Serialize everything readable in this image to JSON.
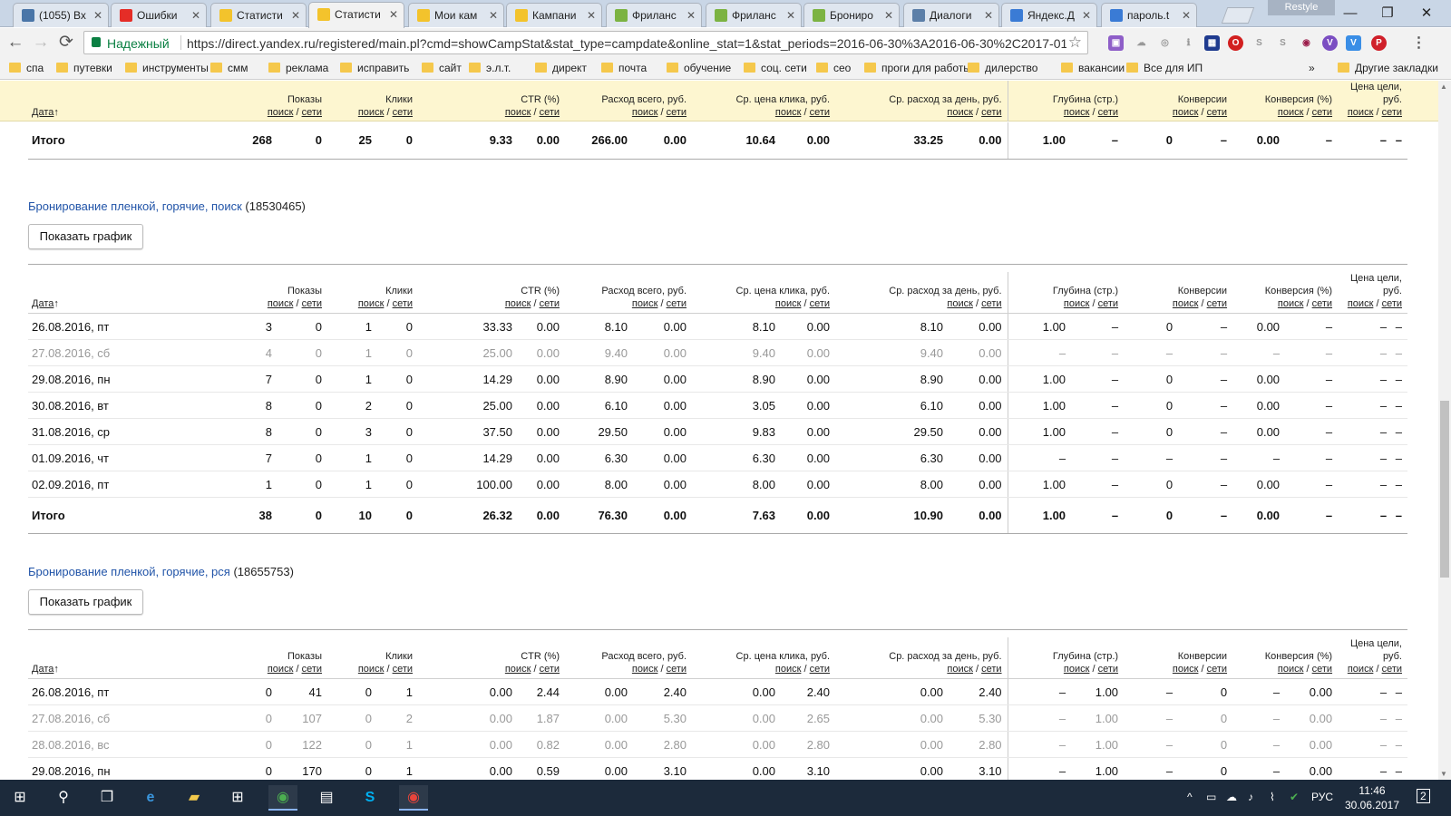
{
  "browser": {
    "tabs": [
      {
        "title": "(1055) Вх",
        "icon": "vk-icon",
        "color": "#4a76a8"
      },
      {
        "title": "Ошибки",
        "icon": "youtube-icon",
        "color": "#e52d27"
      },
      {
        "title": "Статисти",
        "icon": "yandex-direct-icon",
        "color": "#f3c32c"
      },
      {
        "title": "Статисти",
        "icon": "yandex-direct-icon",
        "color": "#f3c32c"
      },
      {
        "title": "Мои кам",
        "icon": "yandex-direct-icon",
        "color": "#f3c32c"
      },
      {
        "title": "Кампани",
        "icon": "yandex-direct-icon",
        "color": "#f3c32c"
      },
      {
        "title": "Фриланс",
        "icon": "fl-ru-icon",
        "color": "#7cb342"
      },
      {
        "title": "Фриланс",
        "icon": "fl-ru-icon",
        "color": "#7cb342"
      },
      {
        "title": "Брониро",
        "icon": "fl-ru-icon",
        "color": "#7cb342"
      },
      {
        "title": "Диалоги",
        "icon": "dialog-icon",
        "color": "#5c7fa8"
      },
      {
        "title": "Яндекс.Д",
        "icon": "yandex-disk-icon",
        "color": "#3a7bd5"
      },
      {
        "title": "пароль.t",
        "icon": "document-icon",
        "color": "#3a7bd5"
      }
    ],
    "active_tab_index": 3,
    "restyle_label": "Restyle",
    "secure_label": "Надежный",
    "url": "https://direct.yandex.ru/registered/main.pl?cmd=showCampStat&stat_type=campdate&online_stat=1&stat_periods=2016-06-30%3A2016-06-30%2C2017-01-",
    "bookmarks": [
      "спа",
      "путевки",
      "инструменты",
      "смм",
      "реклама",
      "исправить",
      "сайт",
      "э.л.т.",
      "директ",
      "почта",
      "обучение",
      "соц. сети",
      "сео",
      "проги для работы",
      "дилерство",
      "вакансии",
      "Все для ИП"
    ],
    "bookmarks_more": "»",
    "other_bookmarks": "Другие закладки"
  },
  "table_header": {
    "date": "Дата",
    "sort_arrow": "↑",
    "shows": "Показы",
    "clicks": "Клики",
    "ctr": "CTR (%)",
    "spend": "Расход всего, руб.",
    "avg_click": "Ср. цена клика, руб.",
    "avg_day": "Ср. расход за день, руб.",
    "depth": "Глубина (стр.)",
    "conversions": "Конверсии",
    "conv_rate": "Конверсия (%)",
    "goal_price": "Цена цели, руб.",
    "search": "поиск",
    "slash": "/",
    "networks": "сети"
  },
  "top_total": {
    "label": "Итого",
    "cells": [
      "268",
      "0",
      "25",
      "0",
      "9.33",
      "0.00",
      "266.00",
      "0.00",
      "10.64",
      "0.00",
      "33.25",
      "0.00",
      "1.00",
      "–",
      "0",
      "–",
      "0.00",
      "–",
      "–",
      "–"
    ]
  },
  "campaign1": {
    "name": "Бронирование пленкой, горячие, поиск",
    "id": "(18530465)",
    "show_chart": "Показать график",
    "rows": [
      {
        "date": "26.08.2016, пт",
        "weekend": false,
        "cells": [
          "3",
          "0",
          "1",
          "0",
          "33.33",
          "0.00",
          "8.10",
          "0.00",
          "8.10",
          "0.00",
          "8.10",
          "0.00",
          "1.00",
          "–",
          "0",
          "–",
          "0.00",
          "–",
          "–",
          "–"
        ]
      },
      {
        "date": "27.08.2016, сб",
        "weekend": true,
        "cells": [
          "4",
          "0",
          "1",
          "0",
          "25.00",
          "0.00",
          "9.40",
          "0.00",
          "9.40",
          "0.00",
          "9.40",
          "0.00",
          "–",
          "–",
          "–",
          "–",
          "–",
          "–",
          "–",
          "–"
        ]
      },
      {
        "date": "29.08.2016, пн",
        "weekend": false,
        "cells": [
          "7",
          "0",
          "1",
          "0",
          "14.29",
          "0.00",
          "8.90",
          "0.00",
          "8.90",
          "0.00",
          "8.90",
          "0.00",
          "1.00",
          "–",
          "0",
          "–",
          "0.00",
          "–",
          "–",
          "–"
        ]
      },
      {
        "date": "30.08.2016, вт",
        "weekend": false,
        "cells": [
          "8",
          "0",
          "2",
          "0",
          "25.00",
          "0.00",
          "6.10",
          "0.00",
          "3.05",
          "0.00",
          "6.10",
          "0.00",
          "1.00",
          "–",
          "0",
          "–",
          "0.00",
          "–",
          "–",
          "–"
        ]
      },
      {
        "date": "31.08.2016, ср",
        "weekend": false,
        "cells": [
          "8",
          "0",
          "3",
          "0",
          "37.50",
          "0.00",
          "29.50",
          "0.00",
          "9.83",
          "0.00",
          "29.50",
          "0.00",
          "1.00",
          "–",
          "0",
          "–",
          "0.00",
          "–",
          "–",
          "–"
        ]
      },
      {
        "date": "01.09.2016, чт",
        "weekend": false,
        "cells": [
          "7",
          "0",
          "1",
          "0",
          "14.29",
          "0.00",
          "6.30",
          "0.00",
          "6.30",
          "0.00",
          "6.30",
          "0.00",
          "–",
          "–",
          "–",
          "–",
          "–",
          "–",
          "–",
          "–"
        ]
      },
      {
        "date": "02.09.2016, пт",
        "weekend": false,
        "cells": [
          "1",
          "0",
          "1",
          "0",
          "100.00",
          "0.00",
          "8.00",
          "0.00",
          "8.00",
          "0.00",
          "8.00",
          "0.00",
          "1.00",
          "–",
          "0",
          "–",
          "0.00",
          "–",
          "–",
          "–"
        ]
      }
    ],
    "total": {
      "label": "Итого",
      "cells": [
        "38",
        "0",
        "10",
        "0",
        "26.32",
        "0.00",
        "76.30",
        "0.00",
        "7.63",
        "0.00",
        "10.90",
        "0.00",
        "1.00",
        "–",
        "0",
        "–",
        "0.00",
        "–",
        "–",
        "–"
      ]
    }
  },
  "campaign2": {
    "name": "Бронирование пленкой, горячие, рся",
    "id": "(18655753)",
    "show_chart": "Показать график",
    "rows": [
      {
        "date": "26.08.2016, пт",
        "weekend": false,
        "cells": [
          "0",
          "41",
          "0",
          "1",
          "0.00",
          "2.44",
          "0.00",
          "2.40",
          "0.00",
          "2.40",
          "0.00",
          "2.40",
          "–",
          "1.00",
          "–",
          "0",
          "–",
          "0.00",
          "–",
          "–"
        ]
      },
      {
        "date": "27.08.2016, сб",
        "weekend": true,
        "cells": [
          "0",
          "107",
          "0",
          "2",
          "0.00",
          "1.87",
          "0.00",
          "5.30",
          "0.00",
          "2.65",
          "0.00",
          "5.30",
          "–",
          "1.00",
          "–",
          "0",
          "–",
          "0.00",
          "–",
          "–"
        ]
      },
      {
        "date": "28.08.2016, вс",
        "weekend": true,
        "cells": [
          "0",
          "122",
          "0",
          "1",
          "0.00",
          "0.82",
          "0.00",
          "2.80",
          "0.00",
          "2.80",
          "0.00",
          "2.80",
          "–",
          "1.00",
          "–",
          "0",
          "–",
          "0.00",
          "–",
          "–"
        ]
      },
      {
        "date": "29.08.2016, пн",
        "weekend": false,
        "cells": [
          "0",
          "170",
          "0",
          "1",
          "0.00",
          "0.59",
          "0.00",
          "3.10",
          "0.00",
          "3.10",
          "0.00",
          "3.10",
          "–",
          "1.00",
          "–",
          "0",
          "–",
          "0.00",
          "–",
          "–"
        ]
      }
    ]
  },
  "taskbar": {
    "lang": "РУС",
    "time": "11:46",
    "date": "30.06.2017",
    "notifications": "2"
  }
}
